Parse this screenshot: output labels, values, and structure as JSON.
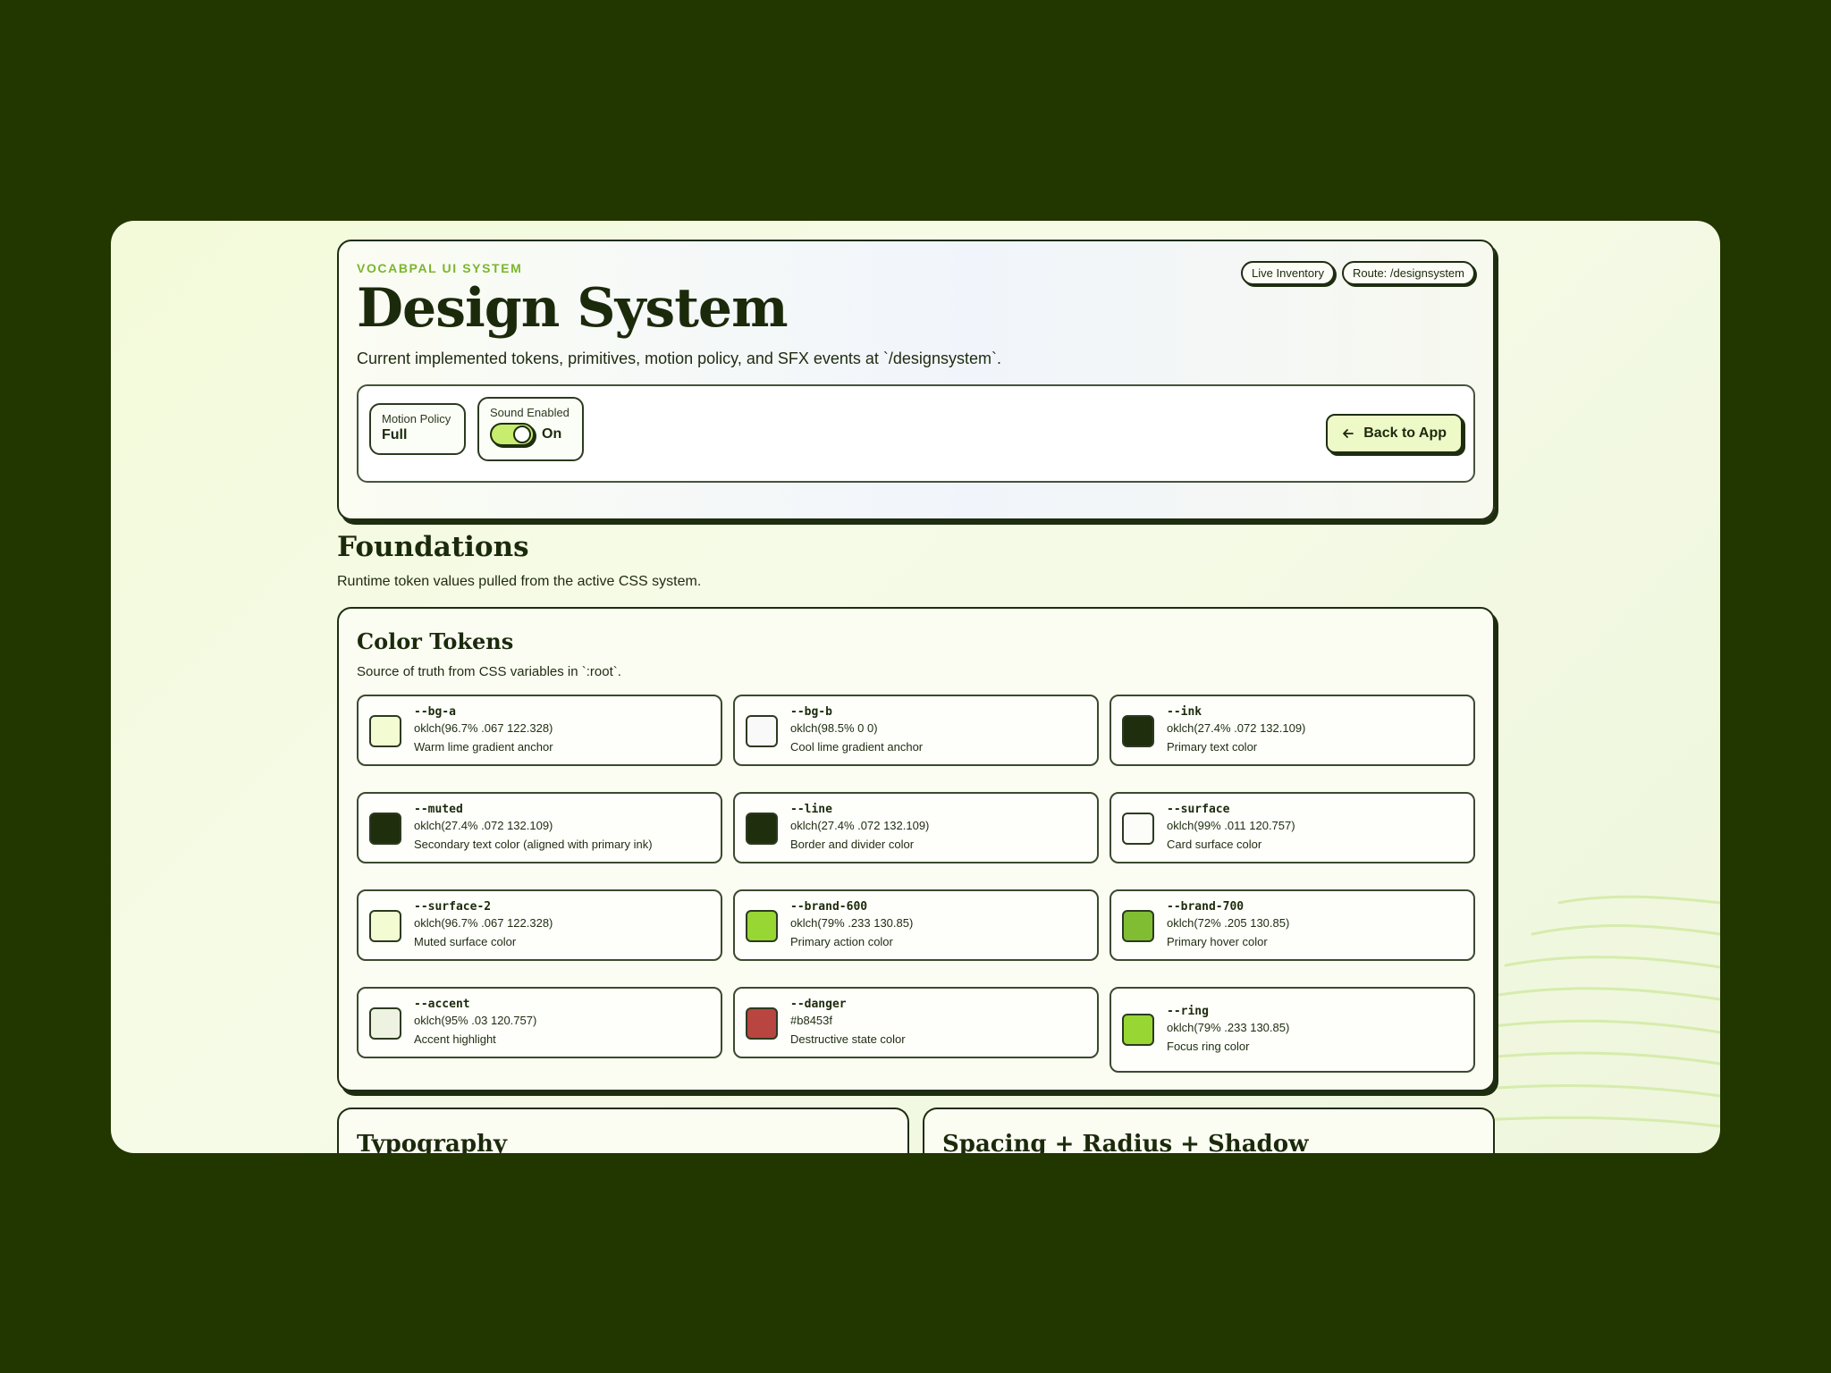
{
  "hero": {
    "eyebrow": "VOCABPAL UI SYSTEM",
    "title": "Design System",
    "subtitle": "Current implemented tokens, primitives, motion policy, and SFX events at `/designsystem`.",
    "badges": [
      "Live Inventory",
      "Route: /designsystem"
    ]
  },
  "controls": {
    "motion_label": "Motion Policy",
    "motion_value": "Full",
    "sound_label": "Sound Enabled",
    "sound_state": "On",
    "back_label": "Back to App"
  },
  "foundations": {
    "title": "Foundations",
    "subtitle": "Runtime token values pulled from the active CSS system."
  },
  "color_tokens": {
    "title": "Color Tokens",
    "subtitle": "Source of truth from CSS variables in `:root`.",
    "items": [
      {
        "name": "--bg-a",
        "value": "oklch(96.7% .067 122.328)",
        "desc": "Warm lime gradient anchor",
        "swatch": "#f2fbd2"
      },
      {
        "name": "--bg-b",
        "value": "oklch(98.5% 0 0)",
        "desc": "Cool lime gradient anchor",
        "swatch": "#f9f9f9"
      },
      {
        "name": "--ink",
        "value": "oklch(27.4% .072 132.109)",
        "desc": "Primary text color",
        "swatch": "#1f2e0d"
      },
      {
        "name": "--muted",
        "value": "oklch(27.4% .072 132.109)",
        "desc": "Secondary text color (aligned with primary ink)",
        "swatch": "#1f2e0d"
      },
      {
        "name": "--line",
        "value": "oklch(27.4% .072 132.109)",
        "desc": "Border and divider color",
        "swatch": "#1f2e0d"
      },
      {
        "name": "--surface",
        "value": "oklch(99% .011 120.757)",
        "desc": "Card surface color",
        "swatch": "#fcfdf8"
      },
      {
        "name": "--surface-2",
        "value": "oklch(96.7% .067 122.328)",
        "desc": "Muted surface color",
        "swatch": "#f2fbd2"
      },
      {
        "name": "--brand-600",
        "value": "oklch(79% .233 130.85)",
        "desc": "Primary action color",
        "swatch": "#97d633"
      },
      {
        "name": "--brand-700",
        "value": "oklch(72% .205 130.85)",
        "desc": "Primary hover color",
        "swatch": "#80bd33"
      },
      {
        "name": "--accent",
        "value": "oklch(95% .03 120.757)",
        "desc": "Accent highlight",
        "swatch": "#eef3e1"
      },
      {
        "name": "--danger",
        "value": "#b8453f",
        "desc": "Destructive state color",
        "swatch": "#b8453f"
      },
      {
        "name": "--ring",
        "value": "oklch(79% .233 130.85)",
        "desc": "Focus ring color",
        "swatch": "#97d633"
      }
    ]
  },
  "bottom_cards": {
    "typography": "Typography",
    "spacing": "Spacing + Radius + Shadow"
  }
}
